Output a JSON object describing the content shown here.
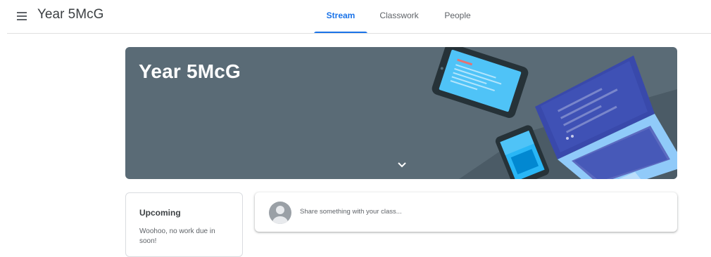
{
  "header": {
    "menu_icon": "hamburger-menu-icon",
    "title": "Year 5McG",
    "tabs": [
      {
        "label": "Stream",
        "active": true
      },
      {
        "label": "Classwork",
        "active": false
      },
      {
        "label": "People",
        "active": false
      }
    ],
    "accent_color": "#1a73e8"
  },
  "banner": {
    "title": "Year 5McG",
    "background_color": "#5a6b76",
    "expand_icon": "chevron-down-icon"
  },
  "upcoming": {
    "title": "Upcoming",
    "text": "Woohoo, no work due in soon!"
  },
  "share": {
    "placeholder": "Share something with your class..."
  }
}
